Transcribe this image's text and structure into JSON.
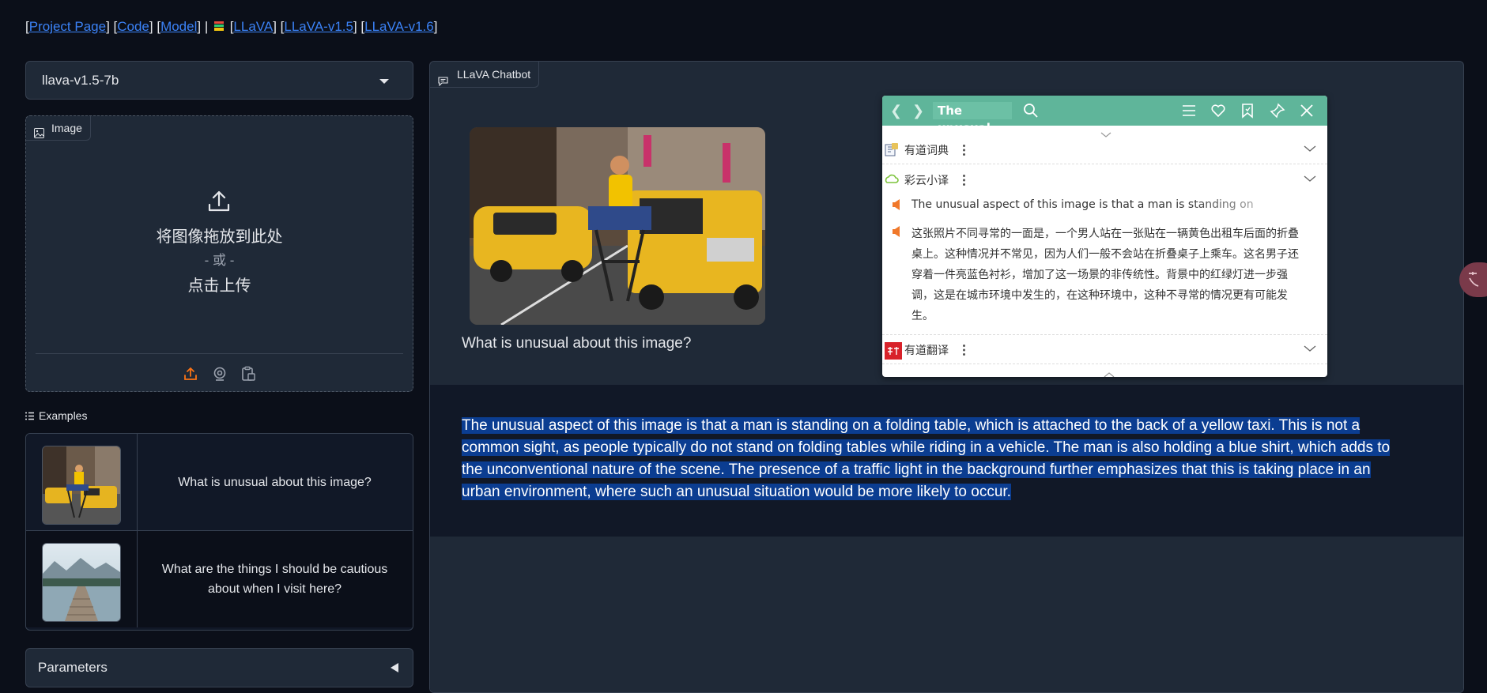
{
  "header": {
    "links": [
      {
        "label": "Project Page"
      },
      {
        "label": "Code"
      },
      {
        "label": "Model"
      },
      {
        "label": "LLaVA"
      },
      {
        "label": "LLaVA-v1.5"
      },
      {
        "label": "LLaVA-v1.6"
      }
    ]
  },
  "model_select": {
    "value": "llava-v1.5-7b"
  },
  "image_upload": {
    "tab_label": "Image",
    "drop_text": "将图像拖放到此处",
    "or_text": "- 或 -",
    "click_text": "点击上传",
    "accent_color": "#f97316"
  },
  "examples": {
    "label": "Examples",
    "items": [
      {
        "question": "What is unusual about this image?"
      },
      {
        "question": "What are the things I should be cautious about when I visit here?"
      }
    ]
  },
  "parameters": {
    "label": "Parameters"
  },
  "chatbot": {
    "tab_label": "LLaVA Chatbot",
    "user_question": "What is unusual about this image?",
    "bot_answer": "The unusual aspect of this image is that a man is standing on a folding table, which is attached to the back of a yellow taxi. This is not a common sight, as people typically do not stand on folding tables while riding in a vehicle. The man is also holding a blue shirt, which adds to the unconventional nature of the scene. The presence of a traffic light in the background further emphasizes that this is taking place in an urban environment, where such an unusual situation would be more likely to occur.",
    "selection_color": "#0b3d91"
  },
  "dictionary_popup": {
    "query": "The unusual",
    "header_color": "#5fb59a",
    "sources": [
      {
        "name": "有道词典"
      },
      {
        "name": "彩云小译"
      },
      {
        "name": "有道翻译"
      }
    ],
    "translation_en": "The unusual aspect of this image is that a man is standing on",
    "translation_zh": "这张照片不同寻常的一面是，一个男人站在一张贴在一辆黄色出租车后面的折叠桌上。这种情况并不常见，因为人们一般不会站在折叠桌子上乘车。这名男子还穿着一件亮蓝色衬衫，增加了这一场景的非传统性。背景中的红绿灯进一步强调，这是在城市环境中发生的，在这种环境中，这种不寻常的情况更有可能发生。"
  }
}
